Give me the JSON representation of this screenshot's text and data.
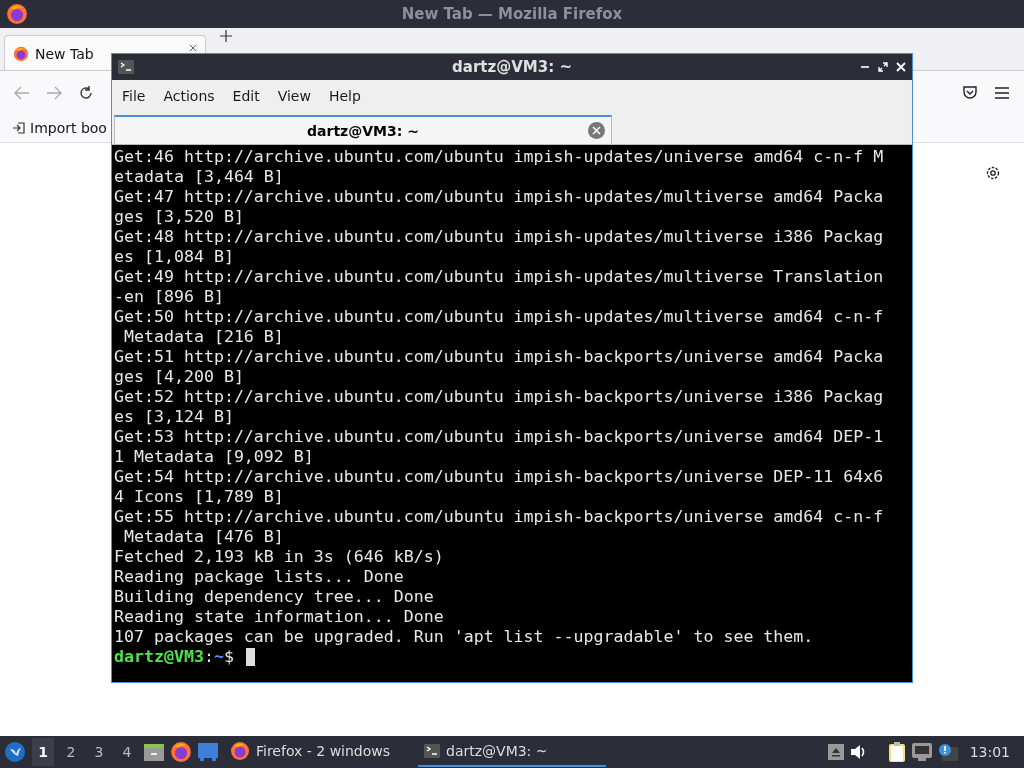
{
  "browser": {
    "title": "New Tab — Mozilla Firefox",
    "tabs": [
      {
        "label": "New Tab",
        "selected": true
      }
    ],
    "bookmarks": [
      {
        "label": "Import boo"
      }
    ]
  },
  "terminal": {
    "title": "dartz@VM3: ~",
    "menu": [
      "File",
      "Actions",
      "Edit",
      "View",
      "Help"
    ],
    "tabs": [
      {
        "label": "dartz@VM3: ~",
        "selected": true
      }
    ],
    "lines": [
      "Get:46 http://archive.ubuntu.com/ubuntu impish-updates/universe amd64 c-n-f M",
      "etadata [3,464 B]",
      "Get:47 http://archive.ubuntu.com/ubuntu impish-updates/multiverse amd64 Packa",
      "ges [3,520 B]",
      "Get:48 http://archive.ubuntu.com/ubuntu impish-updates/multiverse i386 Packag",
      "es [1,084 B]",
      "Get:49 http://archive.ubuntu.com/ubuntu impish-updates/multiverse Translation",
      "-en [896 B]",
      "Get:50 http://archive.ubuntu.com/ubuntu impish-updates/multiverse amd64 c-n-f",
      " Metadata [216 B]",
      "Get:51 http://archive.ubuntu.com/ubuntu impish-backports/universe amd64 Packa",
      "ges [4,200 B]",
      "Get:52 http://archive.ubuntu.com/ubuntu impish-backports/universe i386 Packag",
      "es [3,124 B]",
      "Get:53 http://archive.ubuntu.com/ubuntu impish-backports/universe amd64 DEP-1",
      "1 Metadata [9,092 B]",
      "Get:54 http://archive.ubuntu.com/ubuntu impish-backports/universe DEP-11 64x6",
      "4 Icons [1,789 B]",
      "Get:55 http://archive.ubuntu.com/ubuntu impish-backports/universe amd64 c-n-f",
      " Metadata [476 B]",
      "Fetched 2,193 kB in 3s (646 kB/s)",
      "Reading package lists... Done",
      "Building dependency tree... Done",
      "Reading state information... Done",
      "107 packages can be upgraded. Run 'apt list --upgradable' to see them."
    ],
    "prompt": {
      "user_host": "dartz@VM3",
      "separator": ":",
      "path": "~",
      "symbol": "$"
    }
  },
  "taskbar": {
    "workspaces": [
      {
        "label": "1",
        "selected": true
      },
      {
        "label": "2",
        "selected": false
      },
      {
        "label": "3",
        "selected": false
      },
      {
        "label": "4",
        "selected": false
      }
    ],
    "tasks": [
      {
        "kind": "firefox",
        "label": "Firefox - 2 windows",
        "selected": false
      },
      {
        "kind": "terminal",
        "label": "dartz@VM3: ~",
        "selected": true
      }
    ],
    "clock": "13:01"
  }
}
